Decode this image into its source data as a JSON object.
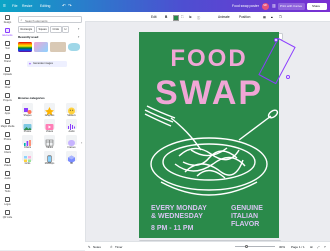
{
  "topbar": {
    "file": "File",
    "resize": "Resize",
    "editing": "Editing",
    "design_title": "Food swap poster",
    "avatar_initials": "SR",
    "print_label": "Print with Canva",
    "share_label": "Share"
  },
  "rail": {
    "items": [
      "Design",
      "Elements",
      "Text",
      "Brand",
      "Uploads",
      "Draw",
      "Projects",
      "Apps",
      "Magic Media",
      "Photos",
      "Charts",
      "Videos",
      "Audio",
      "Tools",
      "Logos",
      "QR code"
    ]
  },
  "panel": {
    "search_placeholder": "Search elements",
    "filters": [
      "Rectangle",
      "Square",
      "Circle",
      "H"
    ],
    "recently_used": "Recently used",
    "generate_label": "Generate images",
    "browse_categories": "Browse categories",
    "categories": [
      {
        "label": "Shapes",
        "icon": "shapes-icon"
      },
      {
        "label": "Graphics",
        "icon": "graphics-icon"
      },
      {
        "label": "Stickers",
        "icon": "stickers-icon"
      },
      {
        "label": "Photos",
        "icon": "photos-icon"
      },
      {
        "label": "Videos",
        "icon": "videos-icon"
      },
      {
        "label": "Audio",
        "icon": "audio-icon"
      },
      {
        "label": "Charts",
        "icon": "charts-icon"
      },
      {
        "label": "Tables",
        "icon": "tables-icon"
      },
      {
        "label": "Frames",
        "icon": "frames-icon"
      },
      {
        "label": "Grids",
        "icon": "grids-icon"
      },
      {
        "label": "Mockups",
        "icon": "mockups-icon"
      },
      {
        "label": "3D",
        "icon": "3d-icon"
      }
    ]
  },
  "toolbar": {
    "edit": "Edit",
    "animate": "Animate",
    "position": "Position"
  },
  "poster": {
    "title_line1": "FOOD",
    "title_line2": "SWAP",
    "schedule_line1": "EVERY MONDAY",
    "schedule_line2": "& WEDNESDAY",
    "time": "8 PM - 11 PM",
    "tag_line1": "GENUINE",
    "tag_line2": "ITALIAN",
    "tag_line3": "FLAVOR"
  },
  "canvas": {
    "ask_canva": "Ask Canva",
    "add_page": "+ Add page"
  },
  "bottombar": {
    "notes": "Notes",
    "timer": "Timer",
    "page_indicator": "Page 1 / 1",
    "zoom": "30%"
  },
  "colors": {
    "poster_green": "#2a8a4a",
    "poster_pink": "#f0a6d6",
    "poster_white": "#ffffff",
    "poster_lilac": "#d8c6f2",
    "accent_purple": "#8b3dff"
  }
}
